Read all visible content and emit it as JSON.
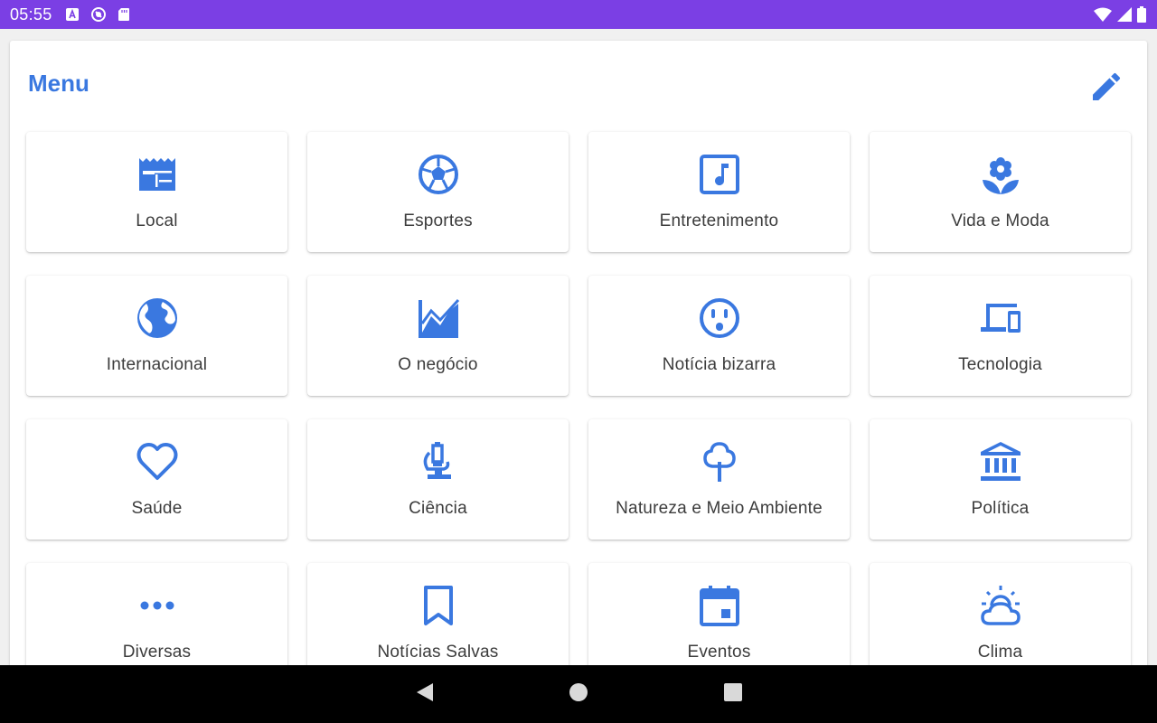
{
  "status_bar": {
    "time": "05:55",
    "left_icons": [
      "text-a-icon",
      "sync-disabled-icon",
      "sd-card-icon"
    ],
    "right_icons": [
      "wifi-icon",
      "cell-signal-icon",
      "battery-icon"
    ]
  },
  "header": {
    "title": "Menu",
    "edit_icon": "pencil-icon"
  },
  "accent_color": "#3a78e0",
  "status_bar_color": "#7b3fe4",
  "categories": [
    {
      "label": "Local",
      "icon": "newspaper-icon"
    },
    {
      "label": "Esportes",
      "icon": "soccer-ball-icon"
    },
    {
      "label": "Entretenimento",
      "icon": "music-note-icon"
    },
    {
      "label": "Vida e Moda",
      "icon": "flower-icon"
    },
    {
      "label": "Internacional",
      "icon": "globe-icon"
    },
    {
      "label": "O negócio",
      "icon": "chart-area-icon"
    },
    {
      "label": "Notícia bizarra",
      "icon": "surprised-face-icon"
    },
    {
      "label": "Tecnologia",
      "icon": "devices-icon"
    },
    {
      "label": "Saúde",
      "icon": "heart-icon"
    },
    {
      "label": "Ciência",
      "icon": "microscope-icon"
    },
    {
      "label": "Natureza e Meio Ambiente",
      "icon": "tree-icon"
    },
    {
      "label": "Política",
      "icon": "government-building-icon"
    },
    {
      "label": "Diversas",
      "icon": "more-dots-icon"
    },
    {
      "label": "Notícias Salvas",
      "icon": "bookmark-icon"
    },
    {
      "label": "Eventos",
      "icon": "calendar-icon"
    },
    {
      "label": "Clima",
      "icon": "weather-cloud-sun-icon"
    }
  ],
  "nav_bar": {
    "buttons": [
      "back-icon",
      "home-icon",
      "recents-icon"
    ]
  }
}
